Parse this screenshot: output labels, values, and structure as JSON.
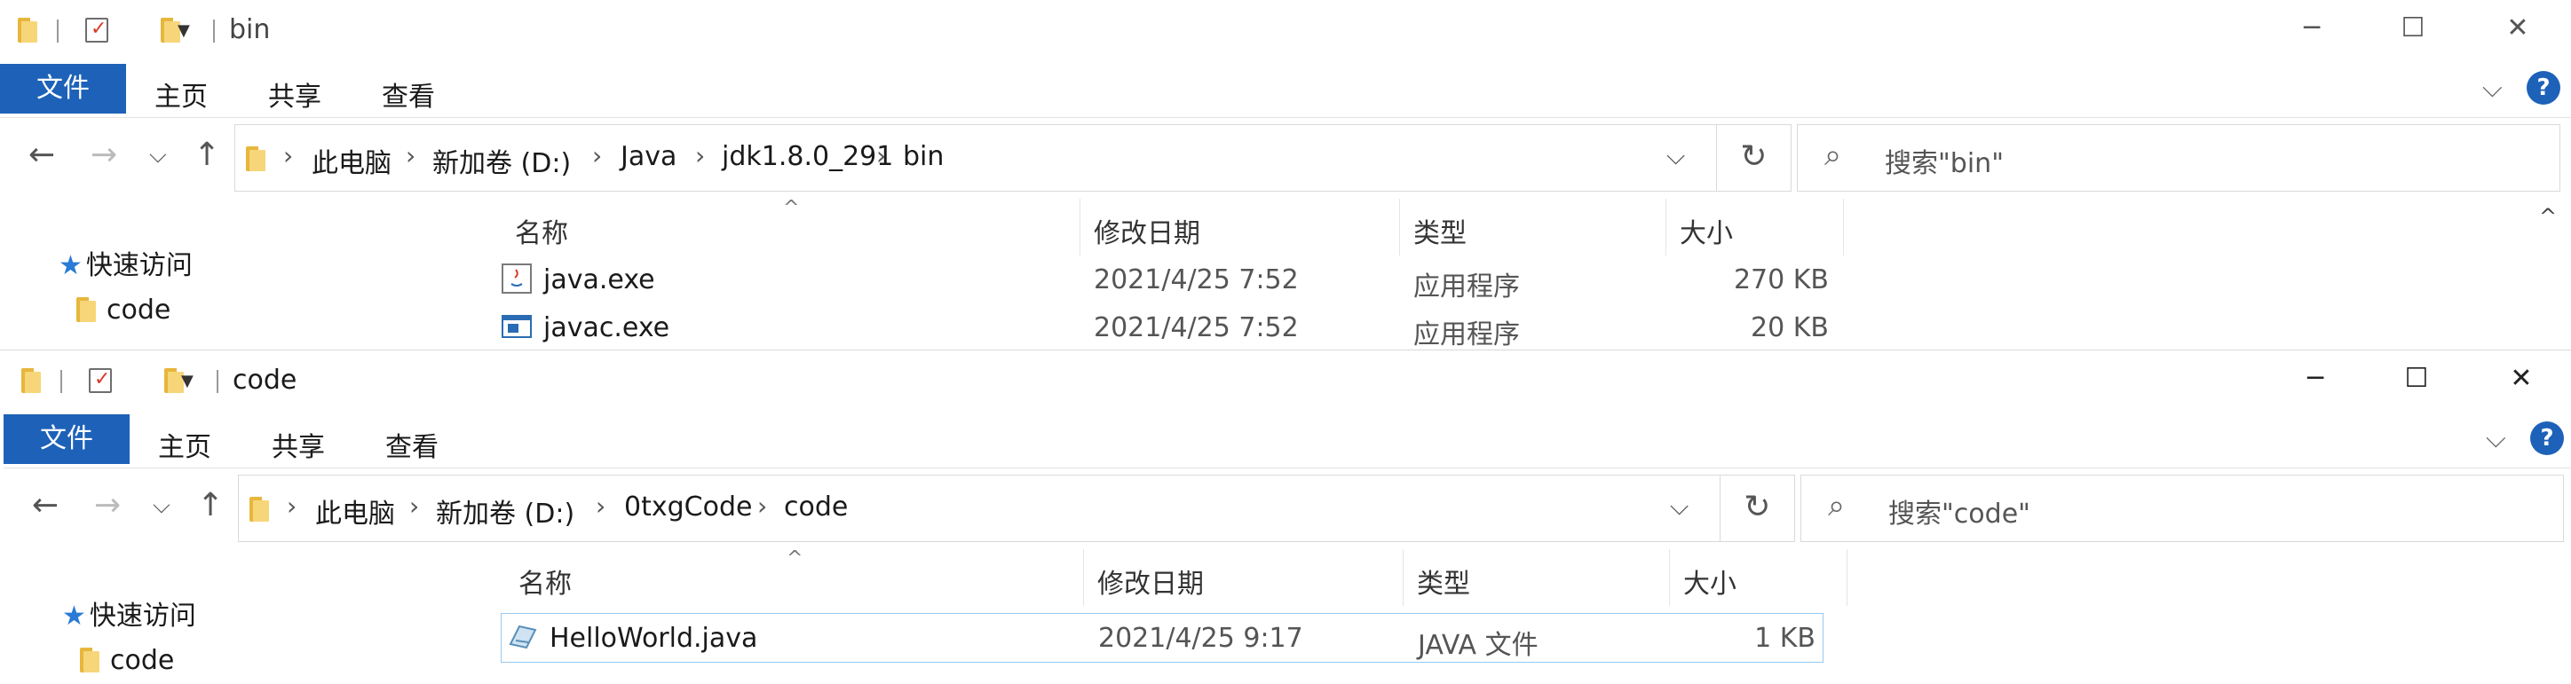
{
  "windows": [
    {
      "title": "bin",
      "ribbon": {
        "file": "文件",
        "tabs": [
          "主页",
          "共享",
          "查看"
        ]
      },
      "breadcrumb": [
        "此电脑",
        "新加卷 (D:)",
        "Java",
        "jdk1.8.0_291",
        "bin"
      ],
      "search_placeholder": "搜索\"bin\"",
      "nav": {
        "quick_access": "快速访问",
        "code": "code"
      },
      "columns": {
        "name": "名称",
        "date": "修改日期",
        "type": "类型",
        "size": "大小"
      },
      "rows": [
        {
          "name": "java.exe",
          "date": "2021/4/25 7:52",
          "type": "应用程序",
          "size": "270 KB",
          "icon": "java-exe-icon"
        },
        {
          "name": "javac.exe",
          "date": "2021/4/25 7:52",
          "type": "应用程序",
          "size": "20 KB",
          "icon": "exe-icon"
        }
      ]
    },
    {
      "title": "code",
      "ribbon": {
        "file": "文件",
        "tabs": [
          "主页",
          "共享",
          "查看"
        ]
      },
      "breadcrumb": [
        "此电脑",
        "新加卷 (D:)",
        "0txgCode",
        "code"
      ],
      "search_placeholder": "搜索\"code\"",
      "nav": {
        "quick_access": "快速访问",
        "code": "code"
      },
      "columns": {
        "name": "名称",
        "date": "修改日期",
        "type": "类型",
        "size": "大小"
      },
      "rows": [
        {
          "name": "HelloWorld.java",
          "date": "2021/4/25 9:17",
          "type": "JAVA 文件",
          "size": "1 KB",
          "icon": "java-file-icon"
        }
      ]
    }
  ],
  "colors": {
    "accent": "#1d62b8",
    "selection_border": "#99c9ef",
    "folder": "#f7d67a"
  }
}
